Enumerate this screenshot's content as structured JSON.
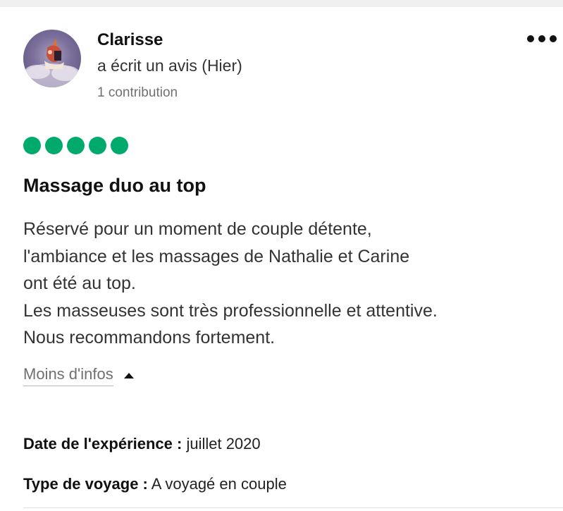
{
  "review": {
    "author": {
      "name": "Clarisse",
      "action": "a écrit un avis (Hier)",
      "contributions": "1 contribution"
    },
    "rating": {
      "value": 5,
      "max": 5,
      "color": "#00aa6c"
    },
    "title": "Massage duo au top",
    "body_lines": [
      "Réservé pour un moment de couple détente,",
      "l'ambiance et les massages de Nathalie et Carine",
      "ont été au top.",
      "Les masseuses sont très professionnelle et attentive.",
      "Nous recommandons fortement."
    ],
    "less_info_label": "Moins d'infos",
    "details": {
      "date_label": "Date de l'expérience :",
      "date_value": "juillet 2020",
      "trip_label": "Type de voyage :",
      "trip_value": "A voyagé en couple"
    }
  },
  "icons": {
    "menu": "more-dots-icon",
    "toggle": "caret-up-icon"
  }
}
